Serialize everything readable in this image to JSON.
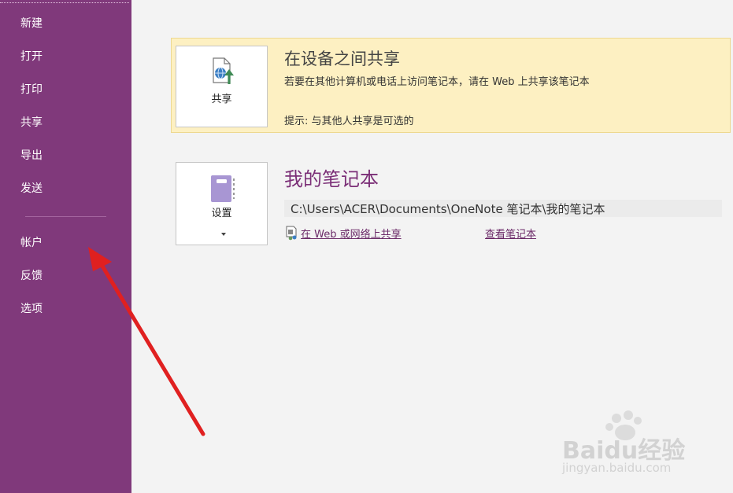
{
  "sidebar": {
    "items": [
      {
        "label": "新建"
      },
      {
        "label": "打开"
      },
      {
        "label": "打印"
      },
      {
        "label": "共享"
      },
      {
        "label": "导出"
      },
      {
        "label": "发送"
      },
      {
        "label": "帐户"
      },
      {
        "label": "反馈"
      },
      {
        "label": "选项"
      }
    ]
  },
  "share_panel": {
    "button_label": "共享",
    "title": "在设备之间共享",
    "description": "若要在其他计算机或电话上访问笔记本，请在 Web 上共享该笔记本",
    "tip": "提示: 与其他人共享是可选的"
  },
  "notebook": {
    "button_label": "设置",
    "title": "我的笔记本",
    "path": "C:\\Users\\ACER\\Documents\\OneNote 笔记本\\我的笔记本",
    "share_link": "在 Web 或网络上共享",
    "view_link": "查看笔记本"
  },
  "watermark": {
    "brand": "Baidu经验",
    "url": "jingyan.baidu.com"
  },
  "colors": {
    "sidebar_bg": "#80397b",
    "share_panel_bg": "#fdf0c2",
    "notebook_title": "#7b2f77",
    "arrow": "#e02020"
  }
}
